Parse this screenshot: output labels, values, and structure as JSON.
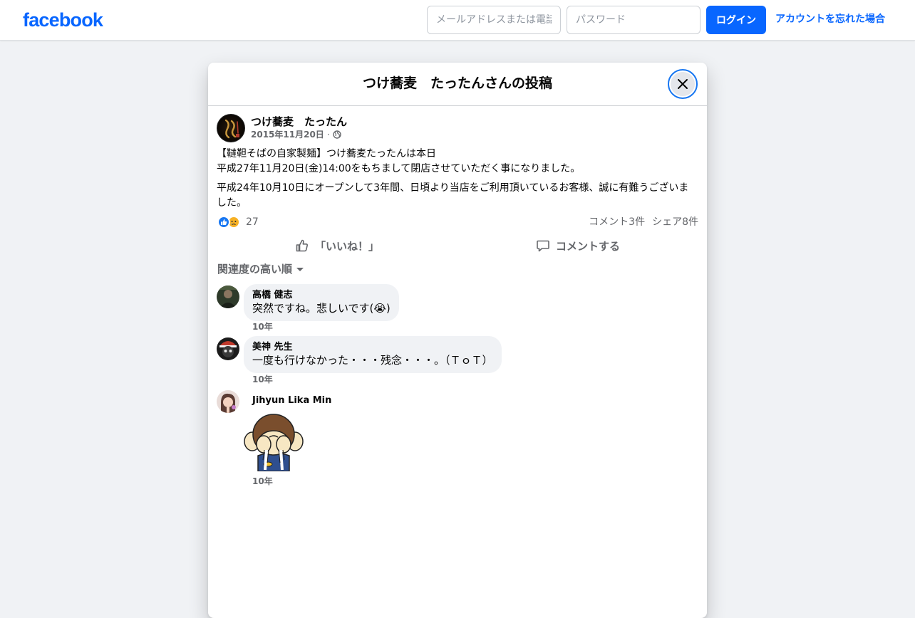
{
  "topbar": {
    "logo": "facebook",
    "email_placeholder": "メールアドレスまたは電話番号",
    "password_placeholder": "パスワード",
    "login_label": "ログイン",
    "forgot_label": "アカウントを忘れた場合"
  },
  "modal": {
    "title": "つけ蕎麦　たったんさんの投稿"
  },
  "post": {
    "author": "つけ蕎麦　たったん",
    "date": "2015年11月20日",
    "separator": "·",
    "paragraphs": [
      "【韃靼そばの自家製麺】つけ蕎麦たったんは本日",
      "平成27年11月20日(金)14:00をもちまして閉店させていただく事になりました。",
      "平成24年10月10日にオープンして3年間、日頃より当店をご利用頂いているお客様、誠に有難うございました。"
    ],
    "reaction_count": "27",
    "comment_count": "コメント3件",
    "share_count": "シェア8件",
    "like_label": "「いいね！」",
    "comment_label": "コメントする"
  },
  "sort": {
    "label": "関連度の高い順"
  },
  "comments": [
    {
      "name": "高橋 健志",
      "text": "突然ですね。悲しいです(😭)",
      "time": "10年"
    },
    {
      "name": "美神 先生",
      "text": "一度も行けなかった・・・残念・・・。（ＴｏＴ）",
      "time": "10年"
    },
    {
      "name": "Jihyun Lika Min",
      "time": "10年"
    }
  ],
  "colors": {
    "brand": "#0866ff",
    "background": "#f0f2f5",
    "secondary_text": "#65676b"
  }
}
